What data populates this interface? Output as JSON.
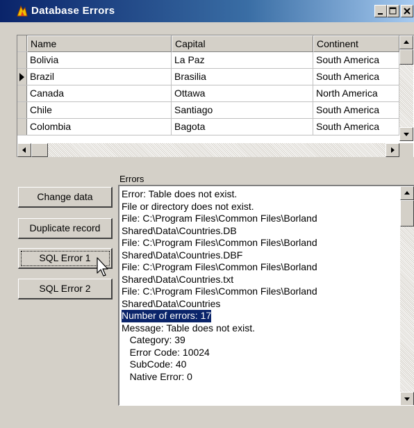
{
  "window": {
    "title": "Database Errors"
  },
  "grid": {
    "columns": [
      "Name",
      "Capital",
      "Continent"
    ],
    "rows": [
      [
        "Bolivia",
        "La Paz",
        "South America"
      ],
      [
        "Brazil",
        "Brasilia",
        "South America"
      ],
      [
        "Canada",
        "Ottawa",
        "North America"
      ],
      [
        "Chile",
        "Santiago",
        "South America"
      ],
      [
        "Colombia",
        "Bagota",
        "South America"
      ]
    ],
    "current_row": 1
  },
  "buttons": {
    "change_data": "Change data",
    "duplicate_record": "Duplicate record",
    "sql_error_1": "SQL Error 1",
    "sql_error_2": "SQL Error 2"
  },
  "errors": {
    "label": "Errors",
    "lines": [
      "Error: Table does not exist.",
      "File or directory does not exist.",
      "File: C:\\Program Files\\Common Files\\Borland",
      "Shared\\Data\\Countries.DB",
      "File: C:\\Program Files\\Common Files\\Borland",
      "Shared\\Data\\Countries.DBF",
      "File: C:\\Program Files\\Common Files\\Borland",
      "Shared\\Data\\Countries.txt",
      "File: C:\\Program Files\\Common Files\\Borland",
      "Shared\\Data\\Countries",
      "Number of errors: 17",
      "Message: Table does not exist.",
      "   Category: 39",
      "   Error Code: 10024",
      "   SubCode: 40",
      "   Native Error: 0"
    ],
    "selected_line": 10
  }
}
